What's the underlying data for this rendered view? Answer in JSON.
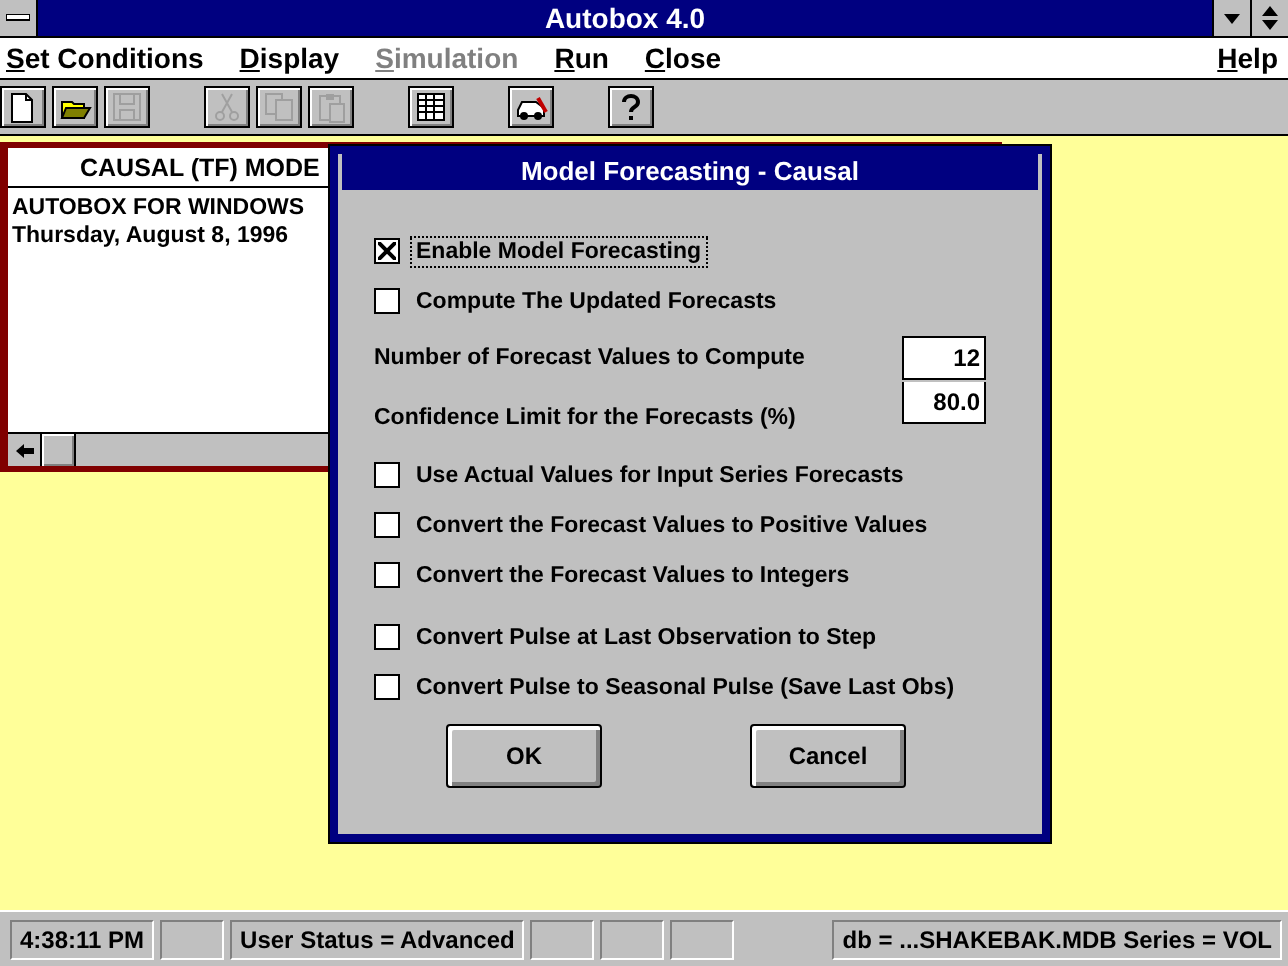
{
  "window": {
    "title": "Autobox 4.0"
  },
  "menu": [
    {
      "label": "Set Conditions",
      "disabled": false
    },
    {
      "label": "Display",
      "disabled": false
    },
    {
      "label": "Simulation",
      "disabled": true
    },
    {
      "label": "Run",
      "disabled": false
    },
    {
      "label": "Close",
      "disabled": false
    },
    {
      "label": "Help",
      "disabled": false
    }
  ],
  "toolbar": [
    {
      "disabled": false
    },
    {
      "disabled": false
    },
    {
      "disabled": true
    },
    {
      "disabled": true
    },
    {
      "disabled": true
    },
    {
      "disabled": true
    },
    {
      "disabled": false
    },
    {
      "disabled": false
    },
    {
      "disabled": false
    }
  ],
  "child_window": {
    "title": "CAUSAL (TF) MODE",
    "lines": [
      "AUTOBOX FOR WINDOWS",
      "Thursday, August 8, 1996"
    ]
  },
  "dialog": {
    "title": "Model Forecasting - Causal",
    "sections": [
      {
        "items": [
          {
            "kind": "checkbox",
            "label": "Enable Model Forecasting",
            "checked": true,
            "focused": true
          },
          {
            "kind": "checkbox",
            "label": "Compute The Updated Forecasts",
            "checked": false,
            "focused": false
          }
        ]
      },
      {
        "items": [
          {
            "kind": "field",
            "label": "Number of Forecast Values to Compute",
            "value": "12"
          },
          {
            "kind": "field",
            "label": "Confidence Limit for the Forecasts (%)",
            "value": "80.0"
          }
        ]
      },
      {
        "items": [
          {
            "kind": "checkbox",
            "label": "Use Actual Values for Input Series Forecasts",
            "checked": false,
            "focused": false
          },
          {
            "kind": "checkbox",
            "label": "Convert the Forecast Values to Positive Values",
            "checked": false,
            "focused": false
          },
          {
            "kind": "checkbox",
            "label": "Convert the Forecast Values to Integers",
            "checked": false,
            "focused": false
          }
        ]
      },
      {
        "items": [
          {
            "kind": "checkbox",
            "label": "Convert Pulse at Last Observation to Step",
            "checked": false,
            "focused": false
          },
          {
            "kind": "checkbox",
            "label": "Convert Pulse to Seasonal Pulse (Save Last Obs)",
            "checked": false,
            "focused": false
          }
        ]
      }
    ],
    "buttons": [
      "OK",
      "Cancel"
    ]
  },
  "status_bar": [
    {
      "kind": "text",
      "text": "4:38:11 PM"
    },
    {
      "kind": "blank"
    },
    {
      "kind": "text",
      "text": "User Status = Advanced"
    },
    {
      "kind": "blank"
    },
    {
      "kind": "blank"
    },
    {
      "kind": "blank"
    },
    {
      "kind": "text",
      "text": "db = ...SHAKEBAK.MDB Series = VOL"
    }
  ]
}
